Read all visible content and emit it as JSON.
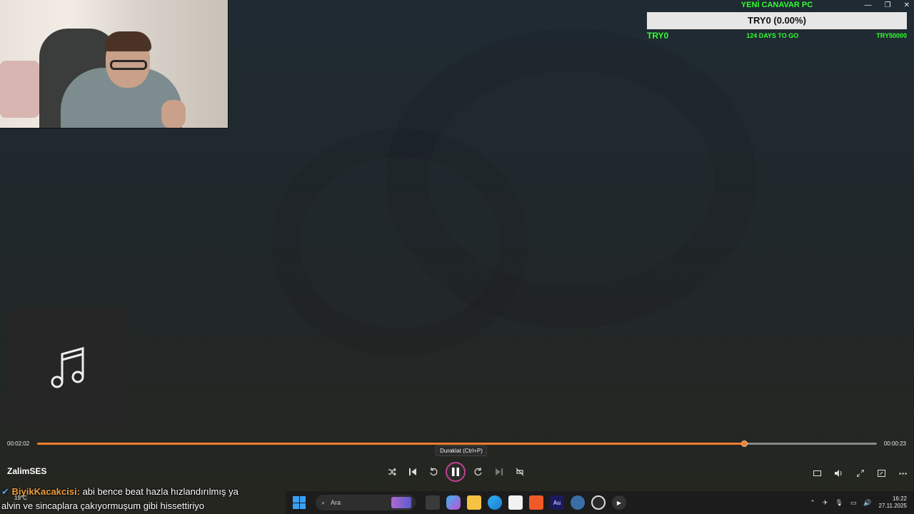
{
  "goal": {
    "title": "YENİ CANAVAR PC",
    "bar_text": "TRY0 (0.00%)",
    "progress_fraction": 0.0,
    "current": "TRY0",
    "days_left": "124 DAYS TO GO",
    "target": "TRY50000"
  },
  "window": {
    "minimize_icon": "minimize-icon",
    "maximize_icon": "maximize-icon",
    "close_icon": "close-icon"
  },
  "player": {
    "elapsed": "00:02:02",
    "remaining": "00:00:23",
    "progress_fraction": 0.842,
    "track_title": "ZalimSES",
    "tooltip": "Duraklat (Ctrl+P)",
    "accent_color": "#f07d2d"
  },
  "chat": {
    "username": "BiyikKacakcisi:",
    "message_line1": "abi bence beat hazla hızlandırılmış ya",
    "message_line2": "alvin ve sincaplara çakıyormuşum gibi hissettiriyo"
  },
  "taskbar": {
    "search_placeholder": "Ara",
    "weather": "19°C",
    "time": "16:22",
    "date": "27.11.2025"
  }
}
